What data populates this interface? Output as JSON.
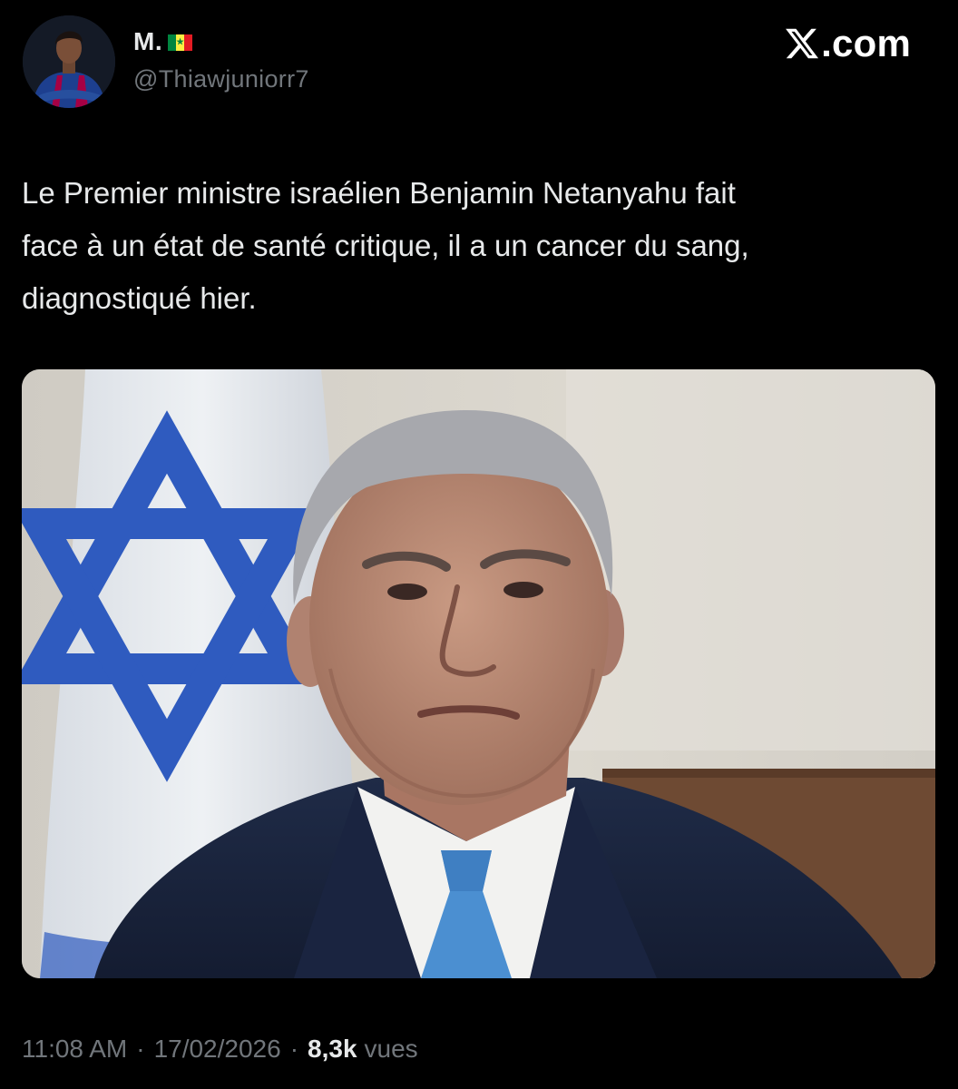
{
  "author": {
    "display_name": "M.",
    "flag_icon": "senegal-flag-icon",
    "handle": "@Thiawjuniorr7"
  },
  "brand": {
    "icon": "x-logo-icon",
    "text": ".com"
  },
  "tweet": {
    "text": "Le Premier ministre israélien Benjamin Netanyahu fait\nface à un état de santé critique, il a un cancer du sang,\ndiagnostiqué hier."
  },
  "meta": {
    "time": "11:08 AM",
    "separator": "·",
    "date": "17/02/2026",
    "views_count": "8,3k",
    "views_label": "vues"
  },
  "colors": {
    "background": "#000000",
    "text_primary": "#e7e9ea",
    "text_secondary": "#71767b",
    "senegal_green": "#00853f",
    "senegal_yellow": "#fdef42",
    "senegal_red": "#e31b23"
  }
}
